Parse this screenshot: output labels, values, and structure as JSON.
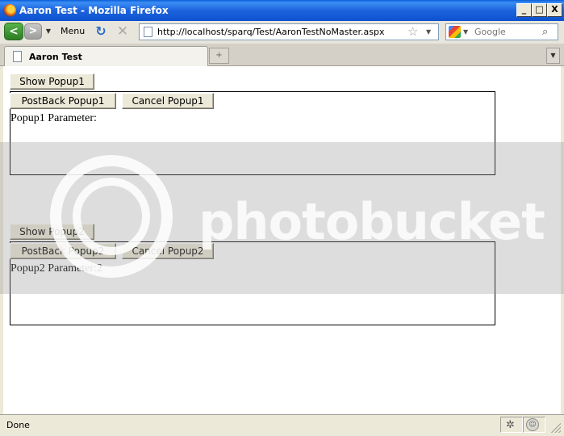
{
  "window": {
    "title": "Aaron Test - Mozilla Firefox",
    "min_label": "_",
    "max_label": "□",
    "close_label": "X"
  },
  "toolbar": {
    "back_glyph": "<",
    "forward_glyph": ">",
    "menu_label": "Menu",
    "reload_glyph": "↻",
    "stop_glyph": "✕",
    "url": "http://localhost/sparq/Test/AaronTestNoMaster.aspx",
    "search_placeholder": "Google"
  },
  "tabs": [
    {
      "label": "Aaron Test",
      "active": true
    }
  ],
  "page": {
    "popup1": {
      "show_label": "Show Popup1",
      "postback_label": "PostBack Popup1",
      "cancel_label": "Cancel Popup1",
      "parameter_text": "Popup1 Parameter:"
    },
    "popup2": {
      "show_label": "Show Popup2",
      "postback_label": "PostBack Popup2",
      "cancel_label": "Cancel Popup2",
      "parameter_text": "Popup2 Parameter:2"
    }
  },
  "watermark": {
    "text": "photobucket"
  },
  "statusbar": {
    "text": "Done"
  },
  "colors": {
    "titlebar": "#0c52cf",
    "chrome": "#ece9d8",
    "page_bg": "#ffffff",
    "popup_border": "#000000"
  }
}
